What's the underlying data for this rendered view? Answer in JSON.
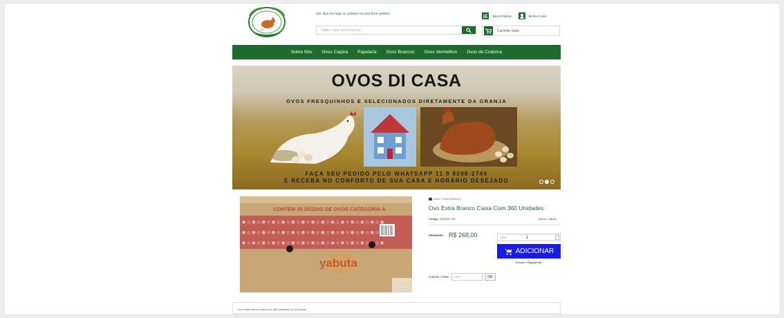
{
  "header": {
    "logo_alt": "OVOS DI CASA",
    "welcome": "Olá, faça seu login ou cadastre-se para fazer pedidos",
    "links": [
      {
        "label": "Meus Pedidos",
        "icon": "list-icon"
      },
      {
        "label": "Minha Conta",
        "icon": "user-icon"
      }
    ],
    "search": {
      "placeholder": "Digite o que você procura"
    },
    "cart": {
      "label": "Carrinho vazio"
    }
  },
  "nav": {
    "items": [
      "Sobre Nós",
      "Ovos Caipira",
      "Papelaria",
      "Ovos Brancos",
      "Ovos Vermelhos",
      "Ovos de Codorna"
    ]
  },
  "banner": {
    "title": "OVOS DI CASA",
    "subtitle": "OVOS FRESQUINHOS E SELECIONADOS DIRETAMENTE DA GRANJA",
    "line1": "FAÇA SEU PEDIDO PELO WHATSAPP 11 9 8098-2749",
    "line2": "E RECEBA NO CONFORTO DE SUA CASA E HORÁRIO DESEJADO",
    "slides": 3,
    "active_slide": 2
  },
  "product": {
    "image": {
      "box_text": "CONTÉM 30 DÚZIAS DE OVOS   CATEGORIA A",
      "brand_mark": "yabuta"
    },
    "breadcrumb": "Início / Ovos Brancos /",
    "title": "Ovo Extra Branco Caixa Com 360 Unidades",
    "code_label": "Código:",
    "code": "562/B91 250",
    "brand": "Marca: Yabuta",
    "old_price": "R$ 293,00",
    "price": "R$ 268,00",
    "qty_label": "Qtde",
    "qty_value": "1",
    "add_label": "ADICIONAR",
    "stock_label": "Estoque:",
    "stock_value": "Disponível",
    "freight_label": "Calcule o frete",
    "cep_placeholder": "CEP",
    "ok_label": "OK"
  },
  "description": "Ovo extra branco caixa com 360 unidades ou 30 dúzias.",
  "colors": {
    "brand_green": "#1f6b2e",
    "add_blue": "#1a1ae6"
  }
}
